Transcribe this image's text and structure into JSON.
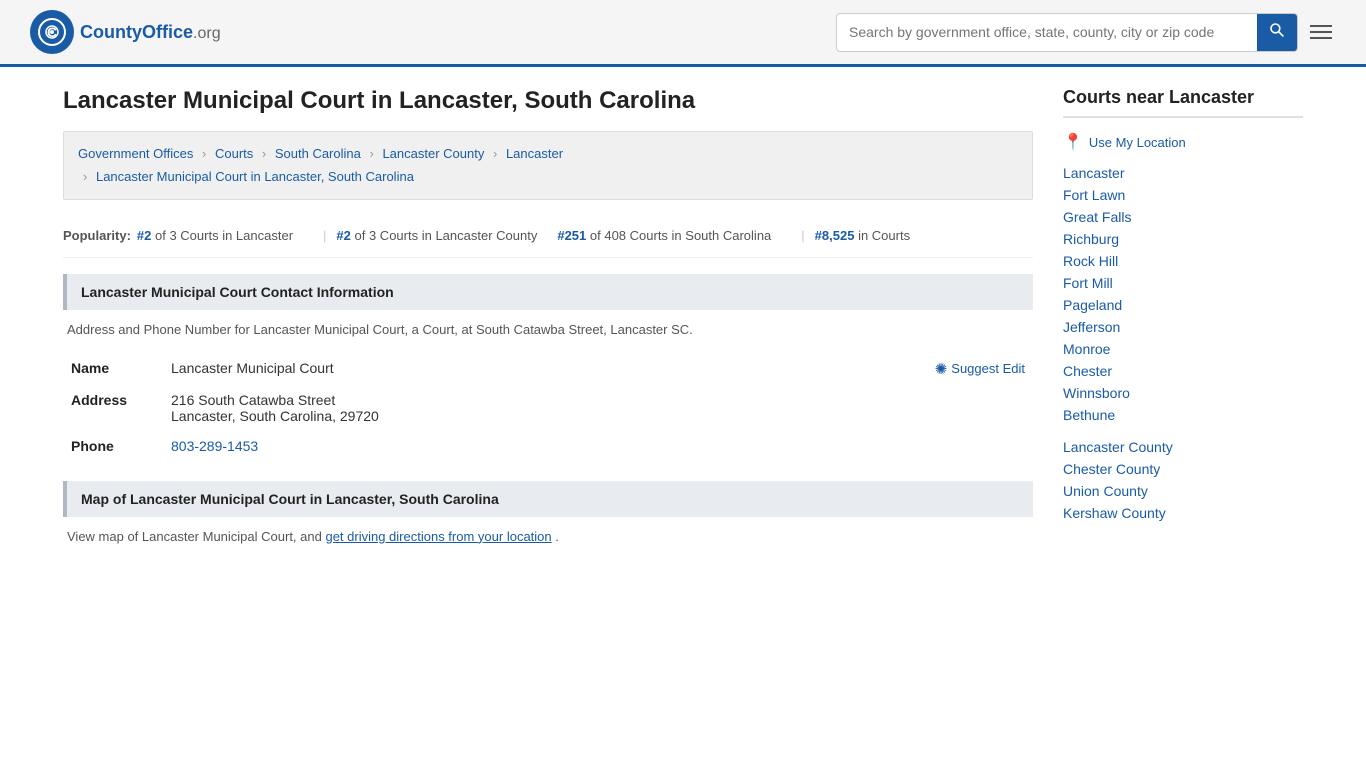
{
  "header": {
    "logo_text": "CountyOffice",
    "logo_org": ".org",
    "search_placeholder": "Search by government office, state, county, city or zip code"
  },
  "page": {
    "title": "Lancaster Municipal Court in Lancaster, South Carolina"
  },
  "breadcrumb": {
    "items": [
      {
        "label": "Government Offices",
        "href": "#"
      },
      {
        "label": "Courts",
        "href": "#"
      },
      {
        "label": "South Carolina",
        "href": "#"
      },
      {
        "label": "Lancaster County",
        "href": "#"
      },
      {
        "label": "Lancaster",
        "href": "#"
      },
      {
        "label": "Lancaster Municipal Court in Lancaster, South Carolina",
        "href": "#"
      }
    ]
  },
  "popularity": {
    "label": "Popularity:",
    "rank1_num": "#2",
    "rank1_text": "of 3 Courts in Lancaster",
    "rank2_num": "#2",
    "rank2_text": "of 3 Courts in Lancaster County",
    "rank3_num": "#251",
    "rank3_text": "of 408 Courts in South Carolina",
    "rank4_num": "#8,525",
    "rank4_text": "in Courts"
  },
  "contact_section": {
    "header": "Lancaster Municipal Court Contact Information",
    "description": "Address and Phone Number for Lancaster Municipal Court, a Court, at South Catawba Street, Lancaster SC.",
    "name_label": "Name",
    "name_value": "Lancaster Municipal Court",
    "address_label": "Address",
    "address_line1": "216 South Catawba Street",
    "address_line2": "Lancaster, South Carolina, 29720",
    "phone_label": "Phone",
    "phone_value": "803-289-1453",
    "suggest_edit": "Suggest Edit"
  },
  "map_section": {
    "header": "Map of Lancaster Municipal Court in Lancaster, South Carolina",
    "description_before": "View map of Lancaster Municipal Court, and",
    "directions_link": "get driving directions from your location",
    "description_after": "."
  },
  "sidebar": {
    "header": "Courts near Lancaster",
    "use_location": "Use My Location",
    "cities": [
      {
        "label": "Lancaster",
        "href": "#"
      },
      {
        "label": "Fort Lawn",
        "href": "#"
      },
      {
        "label": "Great Falls",
        "href": "#"
      },
      {
        "label": "Richburg",
        "href": "#"
      },
      {
        "label": "Rock Hill",
        "href": "#"
      },
      {
        "label": "Fort Mill",
        "href": "#"
      },
      {
        "label": "Pageland",
        "href": "#"
      },
      {
        "label": "Jefferson",
        "href": "#"
      },
      {
        "label": "Monroe",
        "href": "#"
      },
      {
        "label": "Chester",
        "href": "#"
      },
      {
        "label": "Winnsboro",
        "href": "#"
      },
      {
        "label": "Bethune",
        "href": "#"
      }
    ],
    "counties": [
      {
        "label": "Lancaster County",
        "href": "#"
      },
      {
        "label": "Chester County",
        "href": "#"
      },
      {
        "label": "Union County",
        "href": "#"
      },
      {
        "label": "Kershaw County",
        "href": "#"
      }
    ]
  }
}
